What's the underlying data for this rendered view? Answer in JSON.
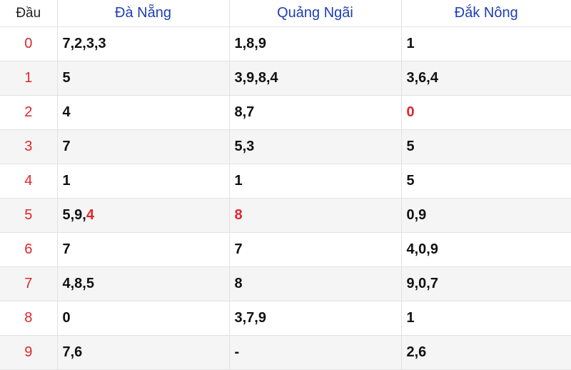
{
  "header": {
    "dau_label": "Đầu",
    "provinces": [
      "Đà Nẵng",
      "Quảng Ngãi",
      "Đắk Nông"
    ]
  },
  "highlight_color": "#e0262b",
  "rows": [
    {
      "dau": "0",
      "cells": [
        [
          {
            "t": "7,2,3,3"
          }
        ],
        [
          {
            "t": "1,8,9"
          }
        ],
        [
          {
            "t": "1"
          }
        ]
      ]
    },
    {
      "dau": "1",
      "cells": [
        [
          {
            "t": "5"
          }
        ],
        [
          {
            "t": "3,9,8,4"
          }
        ],
        [
          {
            "t": "3,6,4"
          }
        ]
      ]
    },
    {
      "dau": "2",
      "cells": [
        [
          {
            "t": "4"
          }
        ],
        [
          {
            "t": "8,7"
          }
        ],
        [
          {
            "t": "0",
            "red": true
          }
        ]
      ]
    },
    {
      "dau": "3",
      "cells": [
        [
          {
            "t": "7"
          }
        ],
        [
          {
            "t": "5,3"
          }
        ],
        [
          {
            "t": "5"
          }
        ]
      ]
    },
    {
      "dau": "4",
      "cells": [
        [
          {
            "t": "1"
          }
        ],
        [
          {
            "t": "1"
          }
        ],
        [
          {
            "t": "5"
          }
        ]
      ]
    },
    {
      "dau": "5",
      "cells": [
        [
          {
            "t": "5,9,"
          },
          {
            "t": "4",
            "red": true
          }
        ],
        [
          {
            "t": "8",
            "red": true
          }
        ],
        [
          {
            "t": "0,9"
          }
        ]
      ]
    },
    {
      "dau": "6",
      "cells": [
        [
          {
            "t": "7"
          }
        ],
        [
          {
            "t": "7"
          }
        ],
        [
          {
            "t": "4,0,9"
          }
        ]
      ]
    },
    {
      "dau": "7",
      "cells": [
        [
          {
            "t": "4,8,5"
          }
        ],
        [
          {
            "t": "8"
          }
        ],
        [
          {
            "t": "9,0,7"
          }
        ]
      ]
    },
    {
      "dau": "8",
      "cells": [
        [
          {
            "t": "0"
          }
        ],
        [
          {
            "t": "3,7,9"
          }
        ],
        [
          {
            "t": "1"
          }
        ]
      ]
    },
    {
      "dau": "9",
      "cells": [
        [
          {
            "t": "7,6"
          }
        ],
        [
          {
            "t": "-"
          }
        ],
        [
          {
            "t": "2,6"
          }
        ]
      ]
    }
  ]
}
